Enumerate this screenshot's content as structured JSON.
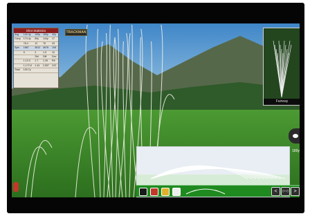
{
  "stats": {
    "title": "Shot Statistics",
    "rows": [
      [
        "Avg",
        "142.4y",
        "100y",
        "163y",
        "42y"
      ],
      [
        "Carry",
        "174.4y",
        "89y",
        "144y",
        "17"
      ],
      [
        "",
        "78.4",
        "12",
        "76",
        "43"
      ],
      [
        "Spin",
        "1867",
        "3612",
        "4678",
        "108"
      ],
      [
        "",
        "5",
        "4",
        "1.5",
        "10"
      ],
      [
        "",
        "",
        "Std",
        "Diff",
        "Dev"
      ],
      [
        "",
        "1.12.0",
        "1.7",
        "1.26",
        "R6"
      ],
      [
        "",
        "1,172.8",
        "1.44",
        "2,557",
        "X22"
      ],
      [
        "Total",
        "130.7y",
        "",
        "",
        ""
      ]
    ]
  },
  "logo": "TRACKMAN",
  "inset": {
    "label": "Fairway"
  },
  "distance": "180y",
  "toolbar": {
    "swatches": [
      "#1a1a1a",
      "#c0392b",
      "#e1b12c",
      "#eeeeee"
    ],
    "prev": "<",
    "collapse": "▷◁",
    "next": ">"
  },
  "colors": {
    "sky": "#5fa3d6",
    "grass": "#3f8f2a",
    "mountain": "#5a6b4a",
    "trace": "#f1f1e6"
  }
}
